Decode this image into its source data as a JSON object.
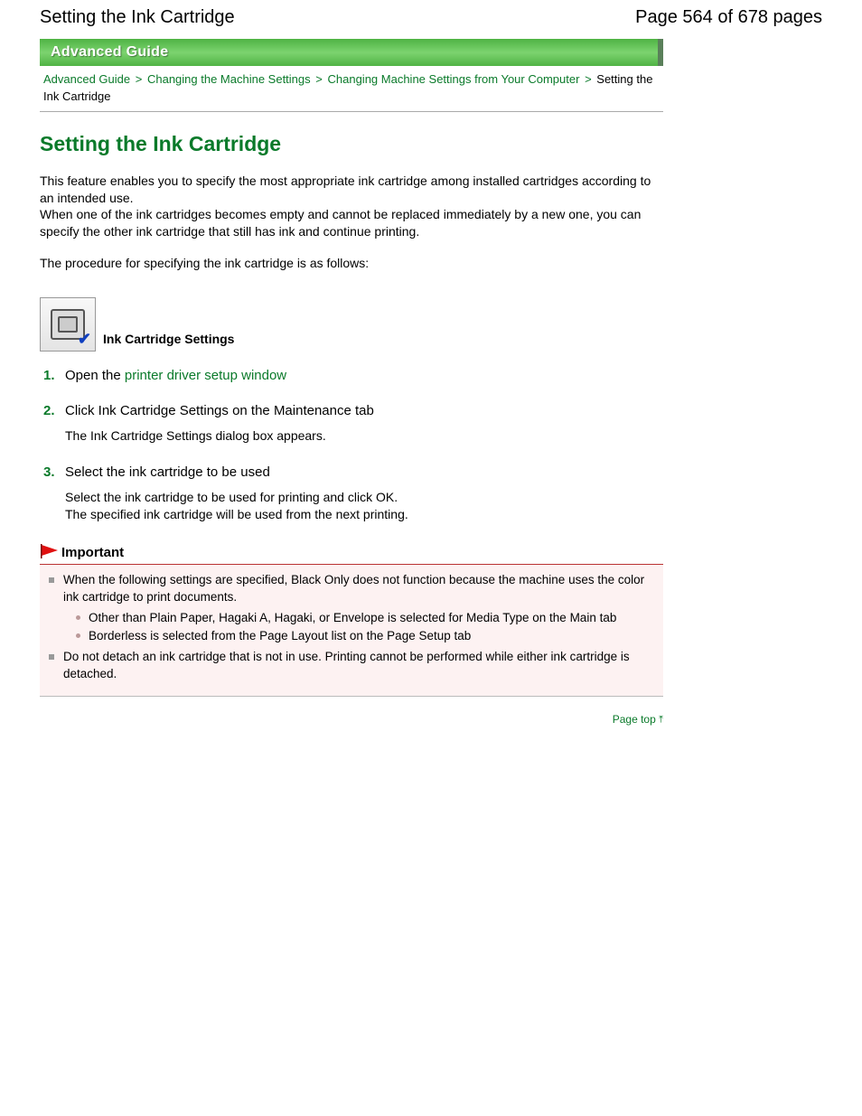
{
  "header": {
    "title": "Setting the Ink Cartridge",
    "page_indicator": "Page 564 of 678 pages"
  },
  "banner": {
    "label": "Advanced Guide"
  },
  "breadcrumb": {
    "items": [
      {
        "label": "Advanced Guide",
        "link": true
      },
      {
        "label": "Changing the Machine Settings",
        "link": true
      },
      {
        "label": "Changing Machine Settings from Your Computer",
        "link": true
      },
      {
        "label": "Setting the Ink Cartridge",
        "link": false
      }
    ],
    "separator": ">"
  },
  "main": {
    "title": "Setting the Ink Cartridge",
    "intro1": "This feature enables you to specify the most appropriate ink cartridge among installed cartridges according to an intended use.",
    "intro2": "When one of the ink cartridges becomes empty and cannot be replaced immediately by a new one, you can specify the other ink cartridge that still has ink and continue printing.",
    "intro3": "The procedure for specifying the ink cartridge is as follows:",
    "icon_label": "Ink Cartridge Settings",
    "steps": [
      {
        "num": "1.",
        "head_prefix": "Open the ",
        "head_link": "printer driver setup window",
        "sub": ""
      },
      {
        "num": "2.",
        "head": "Click Ink Cartridge Settings on the Maintenance tab",
        "sub": "The Ink Cartridge Settings dialog box appears."
      },
      {
        "num": "3.",
        "head": "Select the ink cartridge to be used",
        "sub": "Select the ink cartridge to be used for printing and click OK.\nThe specified ink cartridge will be used from the next printing."
      }
    ],
    "important": {
      "label": "Important",
      "items": [
        {
          "text": "When the following settings are specified, Black Only does not function because the machine uses the color ink cartridge to print documents.",
          "subitems": [
            "Other than Plain Paper, Hagaki A, Hagaki, or Envelope is selected for Media Type on the Main tab",
            "Borderless is selected from the Page Layout list on the Page Setup tab"
          ]
        },
        {
          "text": "Do not detach an ink cartridge that is not in use. Printing cannot be performed while either ink cartridge is detached."
        }
      ]
    },
    "page_top_label": "Page top"
  }
}
